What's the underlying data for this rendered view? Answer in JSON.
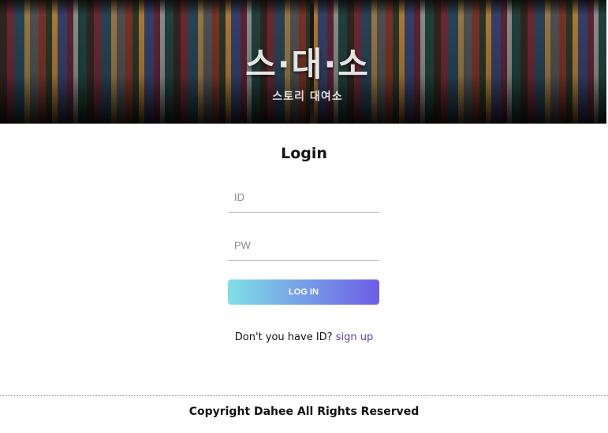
{
  "banner": {
    "logo_main": "스·대·소",
    "logo_sub": "스토리 대여소"
  },
  "login": {
    "title": "Login",
    "id_placeholder": "ID",
    "pw_placeholder": "PW",
    "button_label": "LOG IN",
    "gradient_start": "#7fdfe6",
    "gradient_end": "#6d5de6"
  },
  "signup": {
    "prompt": "Don't you have ID?",
    "link_label": "sign up",
    "link_color": "#5b3fa6"
  },
  "footer": {
    "copyright": "Copyright Dahee All Rights Reserved"
  }
}
